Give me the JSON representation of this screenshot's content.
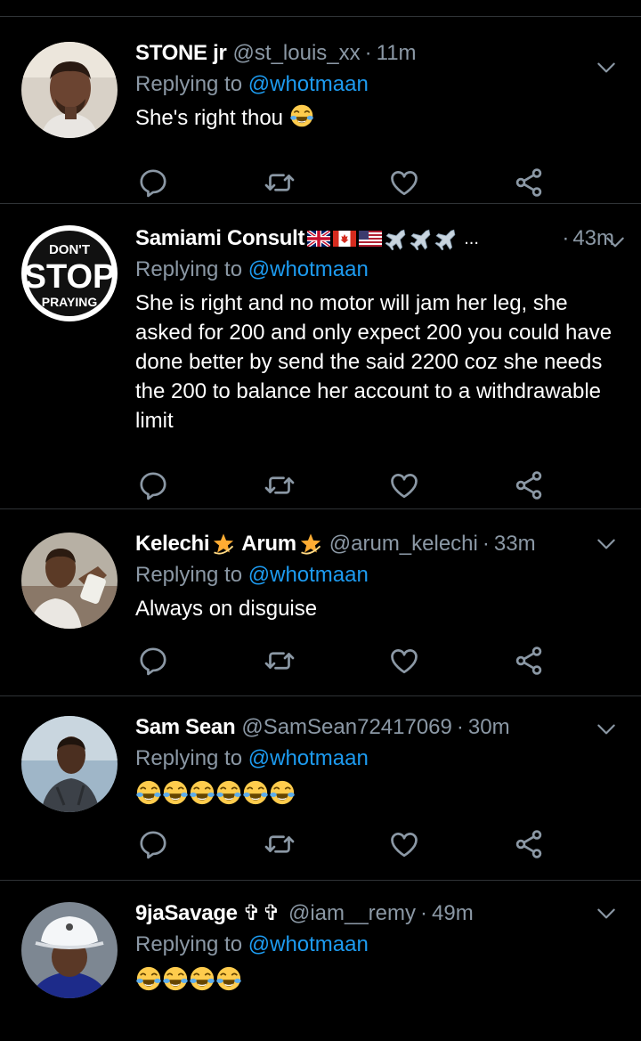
{
  "tweets": [
    {
      "name": "STONE jr",
      "handle": "@st_louis_xx",
      "separator": "·",
      "time": "11m",
      "replying_prefix": "Replying to",
      "replying_to": "@whotmaan",
      "text": "She's right thou",
      "avatar_icon": "avatar-photo"
    },
    {
      "name": "Samiami Consult",
      "name_suffix": "...",
      "separator": "·",
      "time": "43m",
      "replying_prefix": "Replying to",
      "replying_to": "@whotmaan",
      "text": "She is right and no motor will jam her leg, she asked for 200 and only expect 200 you could have done better by send the said 2200 coz she needs the 200 to balance her account to a withdrawable limit",
      "avatar_text": {
        "line1": "DON'T",
        "line2": "STOP",
        "line3": "PRAYING"
      }
    },
    {
      "name_first": "Kelechi",
      "name_second": "Arum",
      "handle": "@arum_kelechi",
      "separator": "·",
      "time": "33m",
      "replying_prefix": "Replying to",
      "replying_to": "@whotmaan",
      "text": "Always on disguise"
    },
    {
      "name": "Sam Sean",
      "handle": "@SamSean72417069",
      "separator": "·",
      "time": "30m",
      "replying_prefix": "Replying to",
      "replying_to": "@whotmaan",
      "emoji_count": 6
    },
    {
      "name": "9jaSavage",
      "name_symbols": "✞✞",
      "handle": "@iam__remy",
      "separator": "·",
      "time": "49m",
      "replying_prefix": "Replying to",
      "replying_to": "@whotmaan",
      "emoji_count": 4
    }
  ],
  "colors": {
    "background": "#000000",
    "secondary_text": "#8b98a5",
    "link": "#1d9bf0",
    "divider": "#2f3336"
  }
}
